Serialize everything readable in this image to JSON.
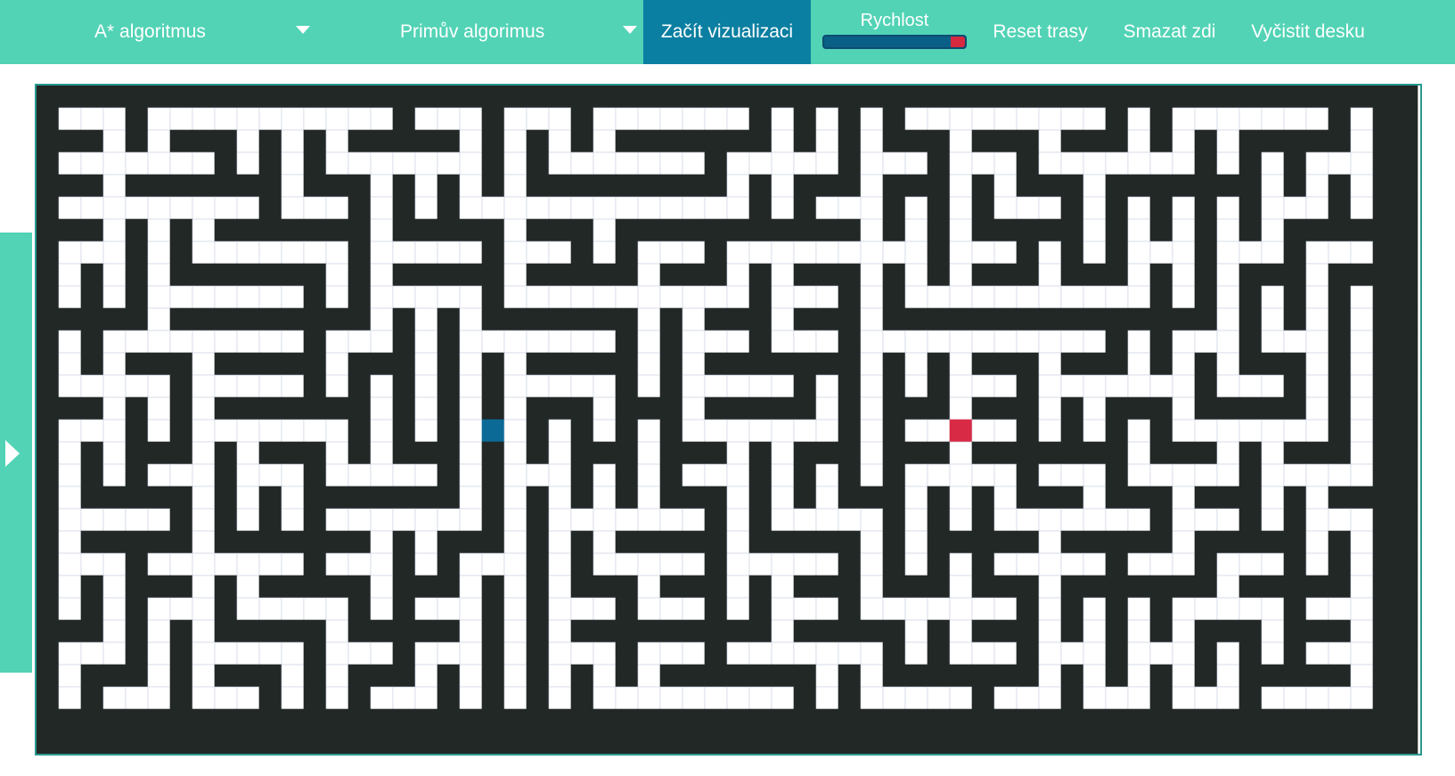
{
  "toolbar": {
    "algorithm_select": {
      "label": "A* algoritmus"
    },
    "maze_select": {
      "label": "Primův algorimus"
    },
    "start_label": "Začít vizualizaci",
    "speed_label": "Rychlost",
    "speed_value": 0.9,
    "reset_path_label": "Reset trasy",
    "clear_walls_label": "Smazat zdi",
    "clear_board_label": "Vyčistit desku"
  },
  "side_panel": {
    "icon": "chevron-right-icon"
  },
  "colors": {
    "accent": "#52d3b5",
    "start_button": "#0b7fa1",
    "wall": "#222826",
    "start_node": "#0c6b96",
    "target_node": "#d92a45",
    "grid_line": "#c8cfe0"
  },
  "grid": {
    "cols": 62,
    "rows": 30,
    "start_node": {
      "col": 20,
      "row": 15
    },
    "target_node": {
      "col": 41,
      "row": 15
    },
    "walls_note": "Maze generated by Prim's algorithm"
  }
}
